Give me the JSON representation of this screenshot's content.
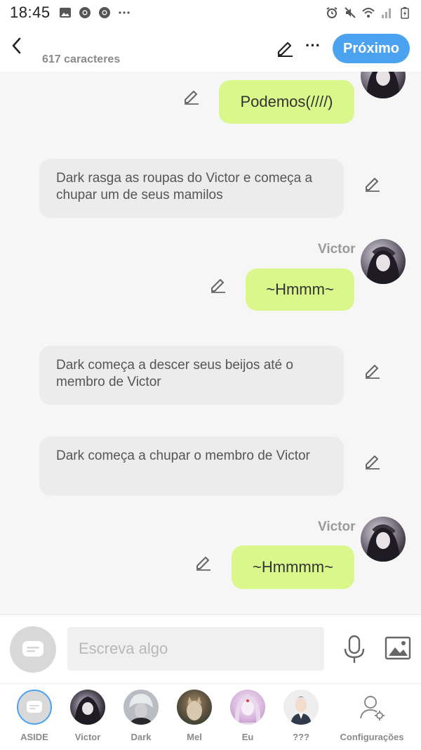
{
  "status_bar": {
    "time": "18:45",
    "icons_left": [
      "image-icon",
      "chrome-icon",
      "chrome-icon",
      "more-horizontal-icon"
    ],
    "icons_right": [
      "alarm-icon",
      "mute-icon",
      "wifi-icon",
      "signal-icon",
      "battery-charging-icon"
    ]
  },
  "header": {
    "char_count": "617 caracteres",
    "next_label": "Próximo"
  },
  "messages": [
    {
      "side": "right",
      "text": "Podemos(////)"
    },
    {
      "side": "left",
      "text": "Dark rasga as roupas do Victor e começa a chupar um de seus mamilos"
    },
    {
      "side": "right",
      "speaker": "Victor",
      "text": "~Hmmm~"
    },
    {
      "side": "left",
      "text": "Dark começa a descer seus beijos até o membro de Victor"
    },
    {
      "side": "left",
      "text": "Dark começa a chupar o membro de Victor"
    },
    {
      "side": "right",
      "speaker": "Victor",
      "text": "~Hmmmm~"
    }
  ],
  "composer": {
    "placeholder": "Escreva algo"
  },
  "bottom_nav": [
    {
      "label": "ASIDE"
    },
    {
      "label": "Victor"
    },
    {
      "label": "Dark"
    },
    {
      "label": "Mel"
    },
    {
      "label": "Eu"
    },
    {
      "label": "???"
    },
    {
      "label": "Configurações"
    }
  ],
  "colors": {
    "accent": "#4ba3ef",
    "bubble_right": "#d9f78a",
    "bubble_left": "#ececec",
    "background": "#f6f6f6"
  }
}
